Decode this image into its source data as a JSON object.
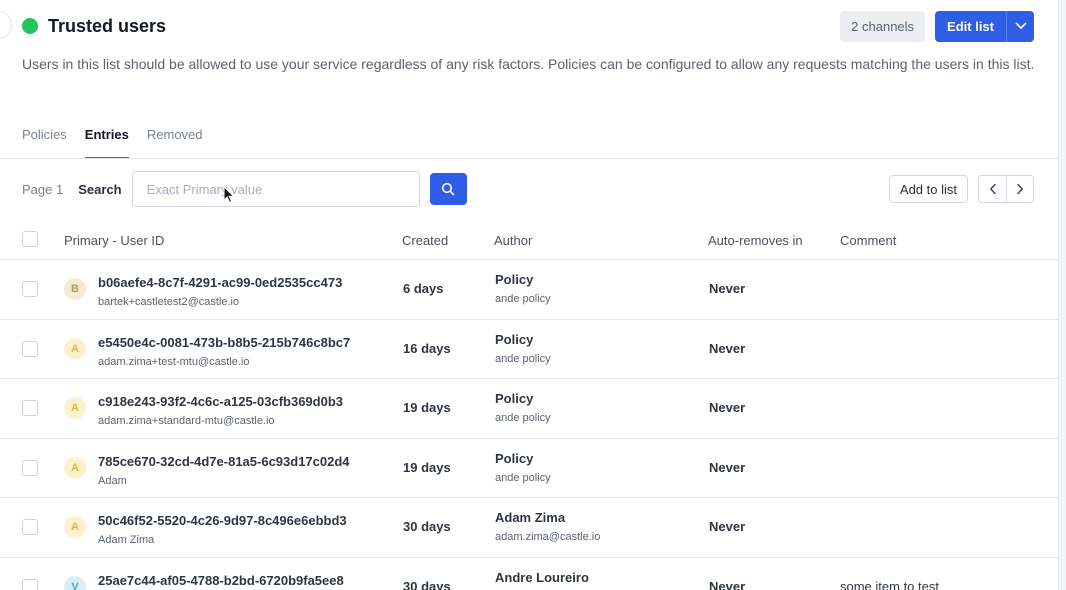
{
  "header": {
    "title": "Trusted users",
    "status_color": "#22c55e",
    "channels_badge": "2 channels",
    "edit_button": "Edit list",
    "description": "Users in this list should be allowed to use your service regardless of any risk factors. Policies can be configured to allow any requests matching the users in this list."
  },
  "tabs": [
    {
      "label": "Policies",
      "active": false
    },
    {
      "label": "Entries",
      "active": true
    },
    {
      "label": "Removed",
      "active": false
    }
  ],
  "toolbar": {
    "page_label": "Page 1",
    "search_label": "Search",
    "search_placeholder": "Exact Primary value",
    "add_button": "Add to list"
  },
  "table": {
    "headers": {
      "primary": "Primary - User ID",
      "created": "Created",
      "author": "Author",
      "auto_removes": "Auto-removes in",
      "comment": "Comment"
    },
    "rows": [
      {
        "avatar": "B",
        "uid": "b06aefe4-8c7f-4291-ac99-0ed2535cc473",
        "sub": "bartek+castletest2@castle.io",
        "created": "6 days",
        "author": "Policy",
        "author_sub": "ande policy",
        "auto_removes": "Never",
        "comment": ""
      },
      {
        "avatar": "A",
        "uid": "e5450e4c-0081-473b-b8b5-215b746c8bc7",
        "sub": "adam.zima+test-mtu@castle.io",
        "created": "16 days",
        "author": "Policy",
        "author_sub": "ande policy",
        "auto_removes": "Never",
        "comment": ""
      },
      {
        "avatar": "A",
        "uid": "c918e243-93f2-4c6c-a125-03cfb369d0b3",
        "sub": "adam.zima+standard-mtu@castle.io",
        "created": "19 days",
        "author": "Policy",
        "author_sub": "ande policy",
        "auto_removes": "Never",
        "comment": ""
      },
      {
        "avatar": "A",
        "uid": "785ce670-32cd-4d7e-81a5-6c93d17c02d4",
        "sub": "Adam",
        "created": "19 days",
        "author": "Policy",
        "author_sub": "ande policy",
        "auto_removes": "Never",
        "comment": ""
      },
      {
        "avatar": "A",
        "uid": "50c46f52-5520-4c26-9d97-8c496e6ebbd3",
        "sub": "Adam Zima",
        "created": "30 days",
        "author": "Adam Zima",
        "author_sub": "adam.zima@castle.io",
        "auto_removes": "Never",
        "comment": ""
      },
      {
        "avatar": "V",
        "uid": "25ae7c44-af05-4788-b2bd-6720b9fa5ee8",
        "sub": "",
        "created": "30 days",
        "author": "Andre Loureiro",
        "author_sub": "",
        "auto_removes": "Never",
        "comment": "some item to test"
      }
    ]
  }
}
